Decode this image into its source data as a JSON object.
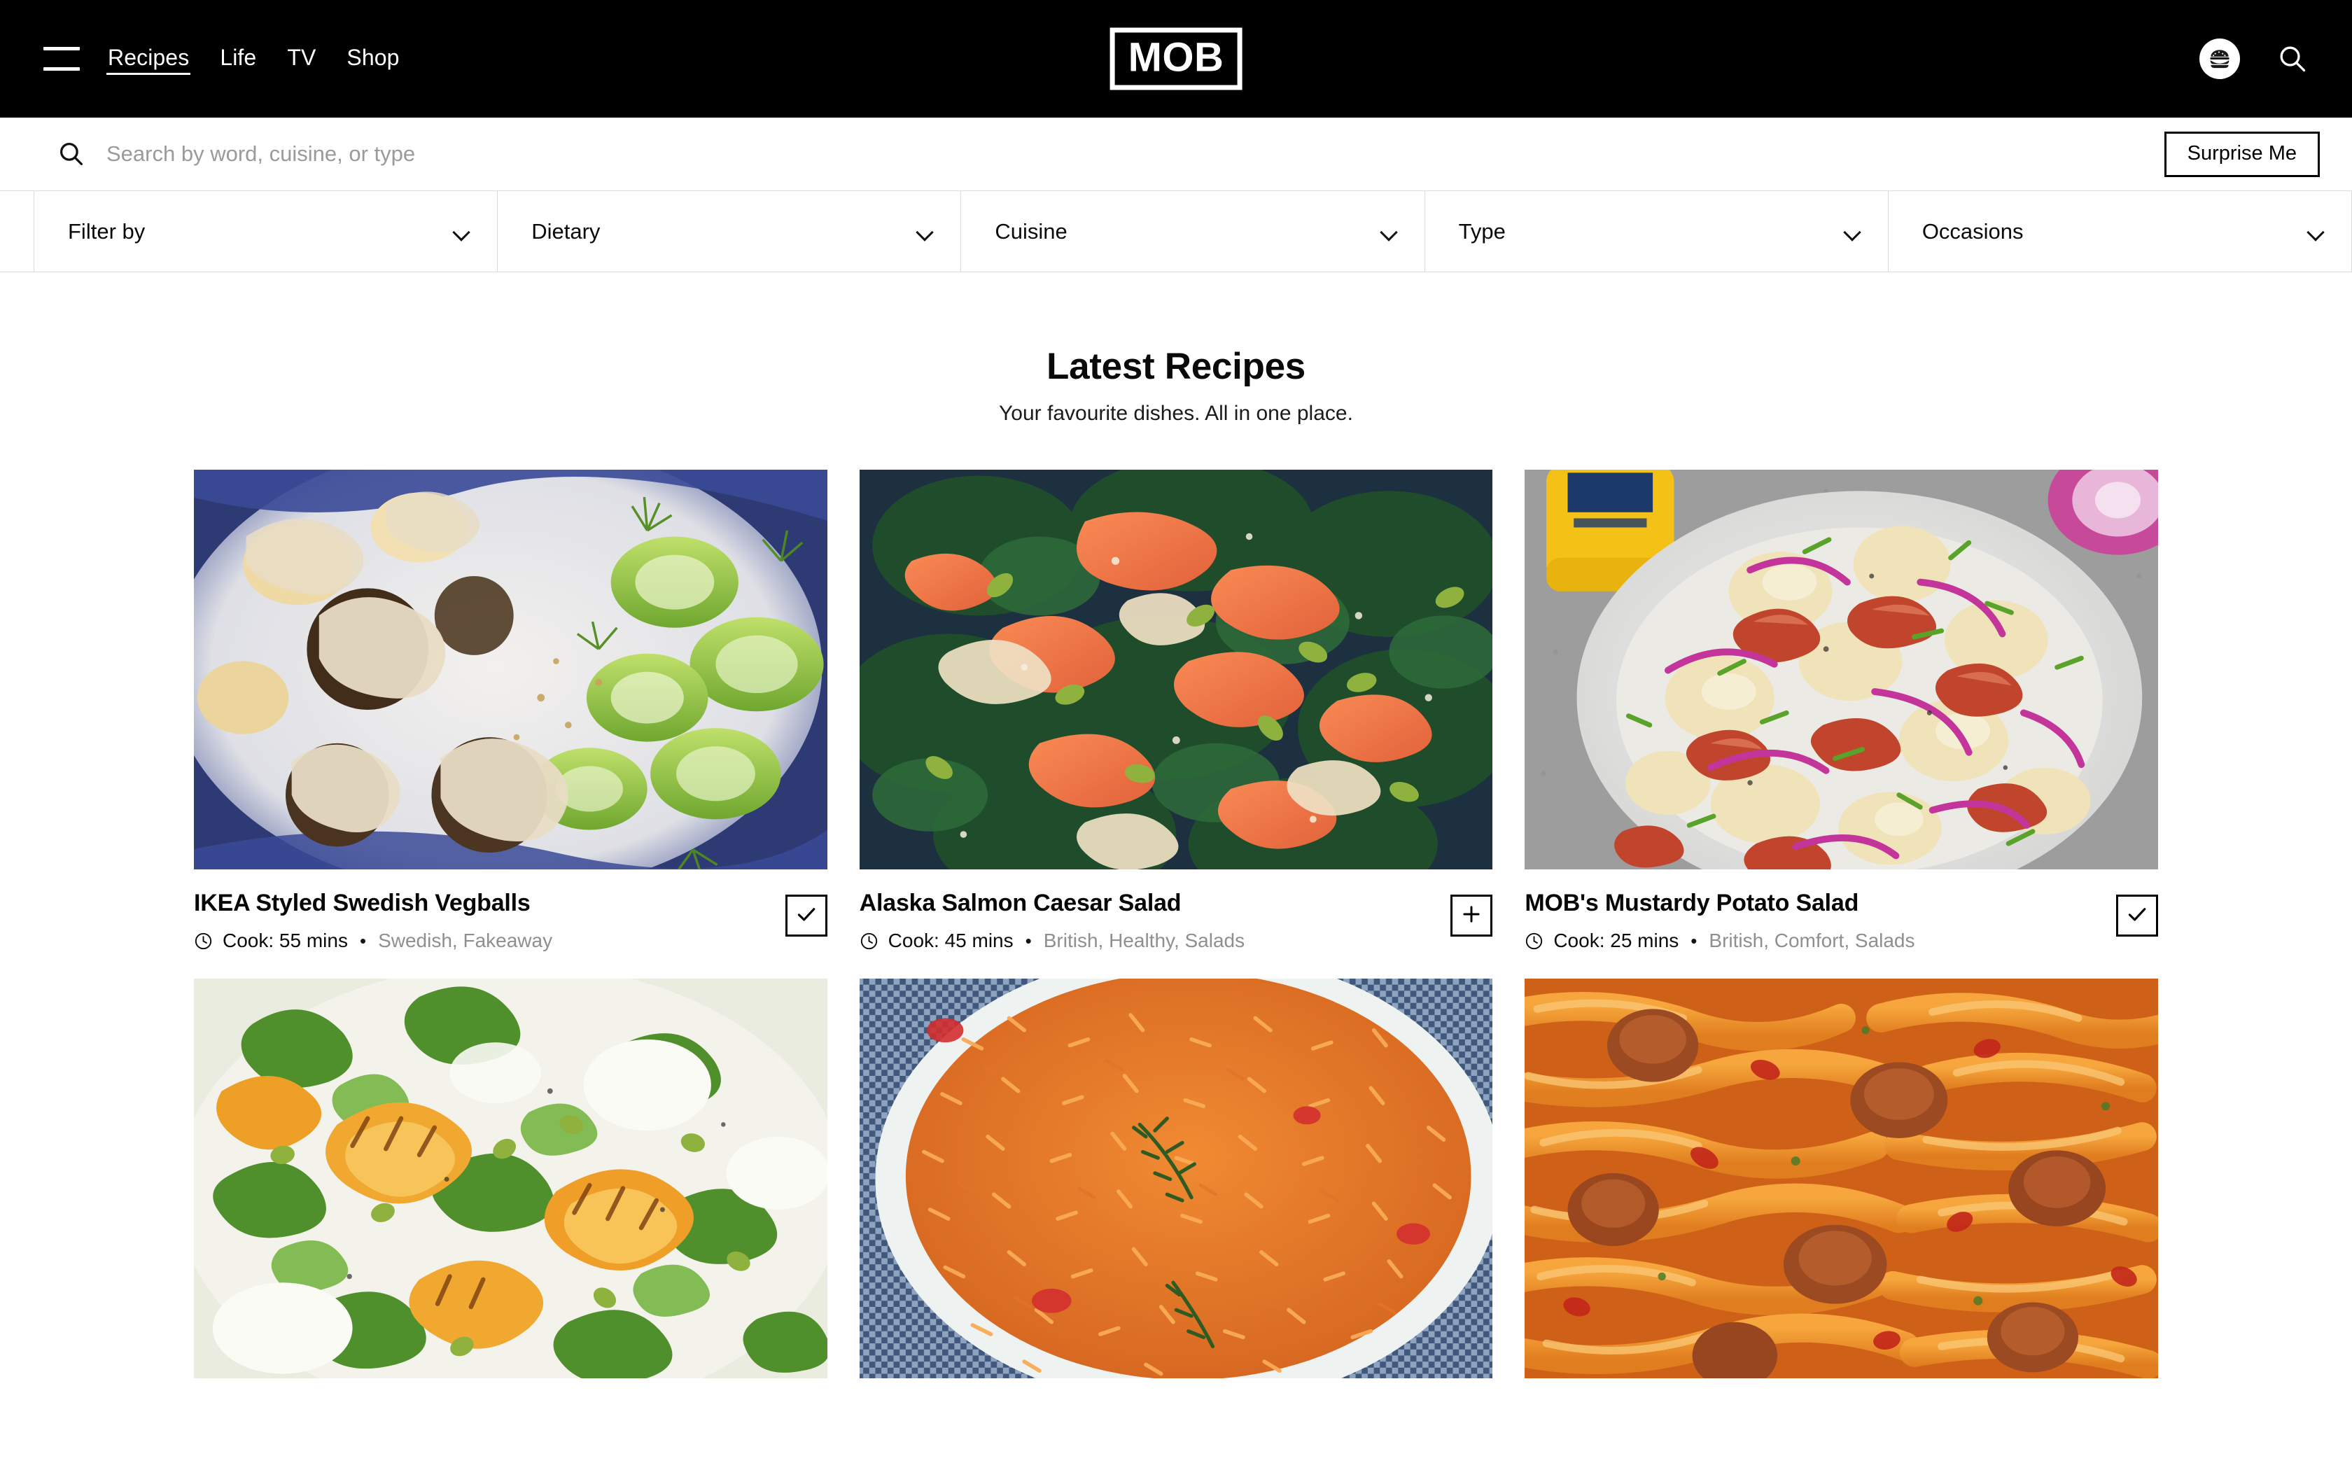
{
  "brand": {
    "logo_text": "MOB"
  },
  "nav": {
    "menu_icon": "hamburger-menu-icon",
    "links": [
      {
        "label": "Recipes",
        "active": true
      },
      {
        "label": "Life",
        "active": false
      },
      {
        "label": "TV",
        "active": false
      },
      {
        "label": "Shop",
        "active": false
      }
    ],
    "avatar_icon": "burger-avatar-icon",
    "search_icon": "search-icon"
  },
  "search": {
    "placeholder": "Search by word, cuisine, or type",
    "value": "",
    "surprise_label": "Surprise Me",
    "icon": "search-icon"
  },
  "filters": [
    {
      "label": "Filter by",
      "icon": "chevron-down-icon"
    },
    {
      "label": "Dietary",
      "icon": "chevron-down-icon"
    },
    {
      "label": "Cuisine",
      "icon": "chevron-down-icon"
    },
    {
      "label": "Type",
      "icon": "chevron-down-icon"
    },
    {
      "label": "Occasions",
      "icon": "chevron-down-icon"
    }
  ],
  "heading": {
    "title": "Latest Recipes",
    "subtitle": "Your favourite dishes. All in one place."
  },
  "recipes": [
    {
      "title": "IKEA Styled Swedish Vegballs",
      "cook": "Cook: 55 mins",
      "separator": "•",
      "tags": "Swedish, Fakeaway",
      "saved": true,
      "save_icon": "check-icon",
      "clock_icon": "clock-icon",
      "image_alt": "swedish-vegballs-photo"
    },
    {
      "title": "Alaska Salmon Caesar Salad",
      "cook": "Cook: 45 mins",
      "separator": "•",
      "tags": "British, Healthy, Salads",
      "saved": false,
      "save_icon": "plus-icon",
      "clock_icon": "clock-icon",
      "image_alt": "salmon-caesar-salad-photo"
    },
    {
      "title": "MOB's Mustardy Potato Salad",
      "cook": "Cook: 25 mins",
      "separator": "•",
      "tags": "British, Comfort, Salads",
      "saved": true,
      "save_icon": "check-icon",
      "clock_icon": "clock-icon",
      "image_alt": "mustardy-potato-salad-photo"
    },
    {
      "title": "",
      "cook": "",
      "separator": "",
      "tags": "",
      "saved": false,
      "save_icon": "",
      "clock_icon": "",
      "image_alt": "peach-burrata-salad-photo"
    },
    {
      "title": "",
      "cook": "",
      "separator": "",
      "tags": "",
      "saved": false,
      "save_icon": "",
      "clock_icon": "",
      "image_alt": "jollof-rice-photo"
    },
    {
      "title": "",
      "cook": "",
      "separator": "",
      "tags": "",
      "saved": false,
      "save_icon": "",
      "clock_icon": "",
      "image_alt": "sausage-pasta-photo"
    }
  ],
  "colors": {
    "nav_background": "#000000",
    "page_background": "#ffffff",
    "text_primary": "#0a0a0a",
    "text_muted": "#8f8f8f",
    "border": "#dcdcdc",
    "accent": "#000000"
  }
}
